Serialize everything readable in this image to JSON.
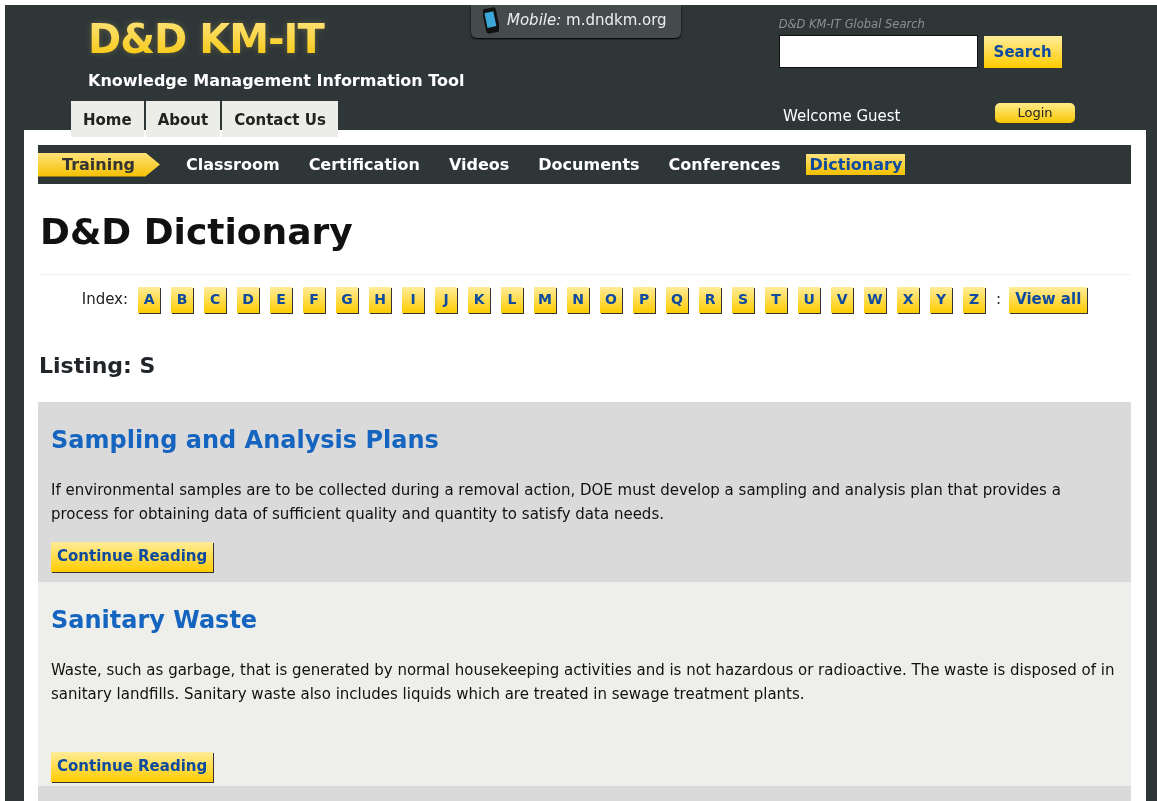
{
  "header": {
    "logo_title": "D&D KM-IT",
    "logo_subtitle": "Knowledge Management Information Tool",
    "mobile": {
      "label": "Mobile:",
      "url": "m.dndkm.org"
    },
    "search": {
      "caption": "D&D KM-IT Global Search",
      "button": "Search"
    },
    "top_tabs": [
      "Home",
      "About",
      "Contact Us"
    ],
    "welcome": "Welcome Guest",
    "login": "Login"
  },
  "subnav": {
    "section": "Training",
    "items": [
      {
        "label": "Classroom",
        "selected": false
      },
      {
        "label": "Certification",
        "selected": false
      },
      {
        "label": "Videos",
        "selected": false
      },
      {
        "label": "Documents",
        "selected": false
      },
      {
        "label": "Conferences",
        "selected": false
      },
      {
        "label": "Dictionary",
        "selected": true
      }
    ]
  },
  "page_title": "D&D Dictionary",
  "index": {
    "label": "Index:",
    "letters": [
      "A",
      "B",
      "C",
      "D",
      "E",
      "F",
      "G",
      "H",
      "I",
      "J",
      "K",
      "L",
      "M",
      "N",
      "O",
      "P",
      "Q",
      "R",
      "S",
      "T",
      "U",
      "V",
      "W",
      "X",
      "Y",
      "Z"
    ],
    "separator": ":",
    "view_all": "View all"
  },
  "listing": "Listing: S",
  "entries": [
    {
      "title": "Sampling and Analysis Plans",
      "text": "If environmental samples are to be collected during a removal action, DOE must develop a sampling and analysis plan that provides a process for obtaining data of sufficient quality and quantity to satisfy data needs.",
      "button": "Continue Reading"
    },
    {
      "title": "Sanitary Waste",
      "text": "Waste, such as garbage, that is generated by normal housekeeping activities and is not hazardous or radioactive. The waste is disposed of in sanitary landfills. Sanitary waste also includes liquids which are treated in sewage treatment plants.",
      "button": "Continue Reading"
    }
  ]
}
